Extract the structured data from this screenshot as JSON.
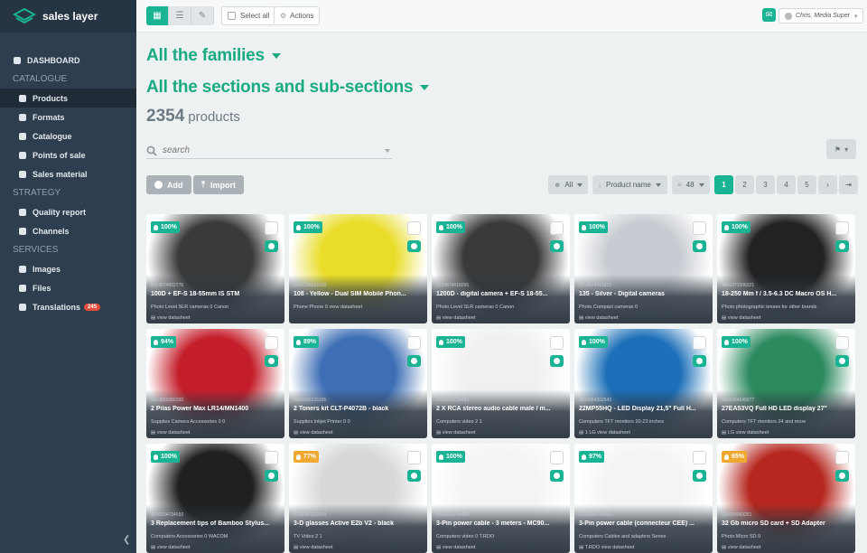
{
  "app": {
    "logo_text": "sales layer"
  },
  "sidebar": {
    "dashboard": "DASHBOARD",
    "sections": [
      {
        "header": "CATALOGUE",
        "items": [
          {
            "label": "Products",
            "icon": "tag-icon",
            "active": true
          },
          {
            "label": "Formats",
            "icon": "formats-icon"
          },
          {
            "label": "Catalogue",
            "icon": "book-icon"
          },
          {
            "label": "Points of sale",
            "icon": "map-pin-icon"
          },
          {
            "label": "Sales material",
            "icon": "file-icon"
          }
        ]
      },
      {
        "header": "STRATEGY",
        "items": [
          {
            "label": "Quality report",
            "icon": "badge-icon"
          },
          {
            "label": "Channels",
            "icon": "share-icon"
          }
        ]
      },
      {
        "header": "SERVICES",
        "items": [
          {
            "label": "Images",
            "icon": "image-icon"
          },
          {
            "label": "Files",
            "icon": "folder-icon"
          },
          {
            "label": "Translations",
            "icon": "globe-icon",
            "badge": "245"
          }
        ]
      }
    ]
  },
  "toolbar": {
    "select_all": "Select all",
    "actions": "Actions",
    "user": "Chris, Media Super"
  },
  "main": {
    "families": "All the families",
    "sections": "All the sections and sub-sections",
    "count_number": "2354",
    "count_label": "products",
    "search_placeholder": "search",
    "add_label": "Add",
    "import_label": "Import",
    "filter_all": "All",
    "sort_label": "Product name",
    "per_page": "48",
    "pages": [
      "1",
      "2",
      "3",
      "4",
      "5"
    ]
  },
  "colors": {
    "accent": "#1ab394",
    "sidebar": "#2e3e4e",
    "score_high": "#1ab394",
    "score_mid": "#f0a830"
  },
  "products": [
    {
      "score": "100%",
      "ean": "8714574602776",
      "title": "100D + EF-S 18-55mm IS STM",
      "meta": "Photo   Level SLR cameras   0   Canon",
      "ds": "view datasheet",
      "bg": "#3a3a3a"
    },
    {
      "score": "100%",
      "ean": "6438158621039",
      "title": "108 - Yellow - Dual SIM Mobile Phon...",
      "meta": "Phone   Phone   0   view datasheet",
      "ds": "",
      "bg": "#e9dd2a"
    },
    {
      "score": "100%",
      "ean": "8714574618265",
      "title": "1200D - digital camera + EF-S 18-55...",
      "meta": "Photo   Level SLR cameras   0   Canon",
      "ds": "view datasheet",
      "bg": "#3a3a3a"
    },
    {
      "score": "100%",
      "ean": "8714574615813",
      "title": "135 - Silver - Digital cameras",
      "meta": "Photo   Compact cameras   0",
      "ds": "view datasheet",
      "bg": "#c8ccd2"
    },
    {
      "score": "100%",
      "ean": "4960371006321",
      "title": "18-250 Mm f / 3.5-6.3 DC Macro OS H...",
      "meta": "Photo   photographic lenses for other brands",
      "ds": "view datasheet",
      "bg": "#222"
    },
    {
      "score": "94%",
      "ean": "5410853056393",
      "title": "2 Pilas Power Max LR14/MN1400",
      "meta": "Supplies   Camera Accessories   0   0",
      "ds": "view datasheet",
      "bg": "#c41e2a"
    },
    {
      "score": "89%",
      "ean": "8806085133155",
      "title": "2 Toners kit CLT-P4072B - black",
      "meta": "Supplies   Inkjet Printer   0   0",
      "ds": "view datasheet",
      "bg": "#3e6fb5"
    },
    {
      "score": "100%",
      "ean": "3700224734482",
      "title": "2 X RCA stereo audio cable male / m...",
      "meta": "Computers   video   2   1",
      "ds": "view datasheet",
      "bg": "#f0f0f0"
    },
    {
      "score": "100%",
      "ean": "8806084352543",
      "title": "22MP55HQ - LED Display 21,5\" Full H...",
      "meta": "Computers   TFT monitors 20-23 inches",
      "ds": "1   LG   view datasheet",
      "bg": "#1c6fb8"
    },
    {
      "score": "100%",
      "ean": "8806084649077",
      "title": "27EA53VQ Full HD LED display 27\"",
      "meta": "Computers   TFT monitors 24 and more",
      "ds": "LG   view datasheet",
      "bg": "#2c8a5e"
    },
    {
      "score": "100%",
      "ean": "3700224734550",
      "title": "3 Replacement tips of Bamboo Stylus...",
      "meta": "Computers   Accessories   0   WACOM",
      "ds": "view datasheet",
      "bg": "#202020"
    },
    {
      "score": "77%",
      "ean": "4718487623314",
      "title": "3-D glasses Active E2b V2 - black",
      "meta": "TV Video   2   1",
      "ds": "view datasheet",
      "bg": "#d6d8da"
    },
    {
      "score": "100%",
      "ean": "3700224734406",
      "title": "3-Pin power cable - 3 meters - MC90...",
      "meta": "Computers   video   0   T.RDO",
      "ds": "view datasheet",
      "bg": "#f4f4f4"
    },
    {
      "score": "97%",
      "ean": "3700224734055",
      "title": "3-Pin power cable (connecteur CEE) ...",
      "meta": "Computers   Cables and adapters Series",
      "ds": "T.RDO   view datasheet",
      "bg": "#f4f4f4"
    },
    {
      "score": "65%",
      "ean": "619659069261",
      "title": "32 Gb micro SD card + SD Adapter",
      "meta": "Photo   Micro SD   0",
      "ds": "view datasheet",
      "bg": "#b5271f"
    }
  ]
}
